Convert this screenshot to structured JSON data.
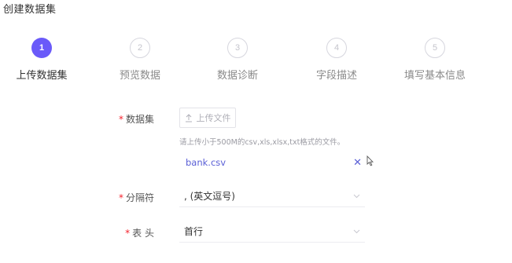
{
  "page": {
    "title": "创建数据集"
  },
  "steps": [
    {
      "number": "1",
      "label": "上传数据集",
      "state": "active"
    },
    {
      "number": "2",
      "label": "预览数据",
      "state": "inactive"
    },
    {
      "number": "3",
      "label": "数据诊断",
      "state": "inactive"
    },
    {
      "number": "4",
      "label": "字段描述",
      "state": "inactive"
    },
    {
      "number": "5",
      "label": "填写基本信息",
      "state": "inactive"
    }
  ],
  "form": {
    "required_mark": "*",
    "dataset": {
      "label": "数据集",
      "upload_label": "上传文件",
      "hint": "请上传小于500M的csv,xls,xlsx,txt格式的文件。",
      "file_name": "bank.csv",
      "remove_symbol": "✕"
    },
    "delimiter": {
      "label": "分隔符",
      "value": ", (英文逗号)"
    },
    "header": {
      "label": "表 头",
      "value": "首行"
    }
  },
  "colors": {
    "accent": "#6a5af9",
    "link": "#5a5fd6",
    "required": "#f5222d"
  },
  "icons": {
    "upload": "upload-icon",
    "remove": "close-icon",
    "dropdown": "chevron-down-icon",
    "pointer": "mouse-pointer-icon"
  }
}
